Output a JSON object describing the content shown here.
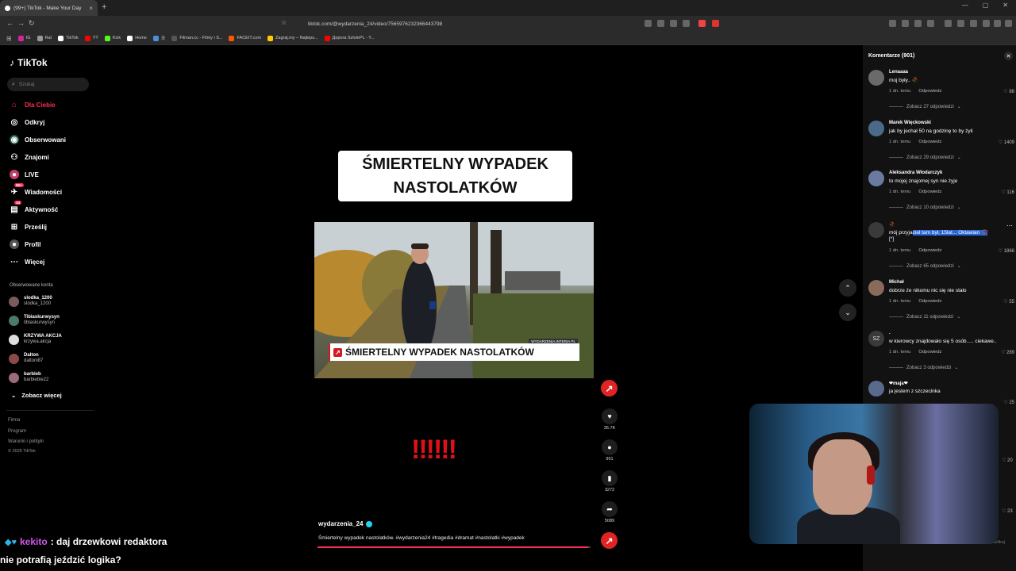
{
  "browser": {
    "tab_title": "(99+) TikTok - Make Your Day",
    "new_tab": "+",
    "url": "tiktok.com/@wydarzenia_24/video/7565976232366443798",
    "bookmarks": [
      "IG",
      "Rat",
      "TikTok",
      "YT",
      "Kick",
      "Home",
      "天",
      "Filman.cc - Filmy i S...",
      "FACEIT.com",
      "Zagraj.my – Najleps...",
      "Дорога SzlolePL - Y..."
    ]
  },
  "sidebar": {
    "logo": "TikTok",
    "search_placeholder": "Szukaj",
    "nav": [
      {
        "label": "Dla Ciebie",
        "icon": "home-icon",
        "active": true
      },
      {
        "label": "Odkryj",
        "icon": "compass-icon"
      },
      {
        "label": "Obserwowani",
        "icon": "followed-icon"
      },
      {
        "label": "Znajomi",
        "icon": "friends-icon"
      },
      {
        "label": "LIVE",
        "icon": "live-icon"
      },
      {
        "label": "Wiadomości",
        "icon": "messages-icon",
        "badge": "99+"
      },
      {
        "label": "Aktywność",
        "icon": "activity-icon",
        "badge": "14"
      },
      {
        "label": "Prześlij",
        "icon": "upload-icon"
      },
      {
        "label": "Profil",
        "icon": "profile-icon"
      },
      {
        "label": "Więcej",
        "icon": "more-icon"
      }
    ],
    "followed_title": "Obserwowane konta",
    "accounts": [
      {
        "name": "slodka_1200",
        "handle": "slodka_1200"
      },
      {
        "name": "Tibiaskurwysyn",
        "handle": "tibiaskurwysyn"
      },
      {
        "name": "KRZYWA AKCJA",
        "handle": "krzywa.akcja"
      },
      {
        "name": "Dalton",
        "handle": "daltoni87"
      },
      {
        "name": "barbieb",
        "handle": "barbiebie22"
      }
    ],
    "see_more": "Zobacz więcej",
    "footer": [
      "Firma",
      "Program",
      "Warunki i polityki",
      "© 2025 TikTok"
    ]
  },
  "video": {
    "headline_line1": "ŚMIERTELNY WYPADEK",
    "headline_line2": "NASTOLATKÓW",
    "lower_third": "ŚMIERTELNY WYPADEK NASTOLATKÓW",
    "source_tag": "WYDARZENIA.INTERIA.PL",
    "exclaim": "!!!!!!",
    "author": "wydarzenia_24",
    "caption": "Śmiertelny wypadek nastolatków. #wydarzenia24 #tragedia #dramat #nastolatki #wypadek",
    "progress": 0.99
  },
  "actions": {
    "likes": "35.7K",
    "comments": "901",
    "saves": "3272",
    "shares": "5089"
  },
  "comments": {
    "title": "Komentarze (901)",
    "items": [
      {
        "user": "Lenaaaa",
        "text": "moj były.. 🥀",
        "time": "1 dn. temu",
        "reply": "Odpowiedz",
        "likes": "88",
        "more": "Zobacz 27 odpowiedzi"
      },
      {
        "user": "Marek Więckowski",
        "text": "jak by jechał 50 na godzinę to by żyli",
        "time": "1 dn. temu",
        "reply": "Odpowiedz",
        "likes": "1409",
        "more": "Zobacz 29 odpowiedzi"
      },
      {
        "user": "Aleksandra Włodarczyk",
        "text": "to mojej znajomej syn nie żyje",
        "time": "1 dn. temu",
        "reply": "Odpowiedz",
        "likes": "116",
        "more": "Zobacz 10 odpowiedzi"
      },
      {
        "user": "🥀",
        "text_plain": "mój przyja",
        "text_selected": "ciel tam był, 15lat... Oktawian 🥀",
        "text_tail": "[*]",
        "time": "1 dn. temu",
        "reply": "Odpowiedz",
        "likes": "1866",
        "more": "Zobacz 65 odpowiedzi"
      },
      {
        "user": "Michał",
        "text": "dobrze że nikomu nic się nie stało",
        "time": "1 dn. temu",
        "reply": "Odpowiedz",
        "likes": "55",
        "more": "Zobacz 11 odpowiedzi"
      },
      {
        "user": ".",
        "avatar_text": "SZ",
        "text": "w kierowcy znajdowało się 5 osób..... ciekawe..",
        "time": "1 dn. temu",
        "reply": "Odpowiedz",
        "likes": "289",
        "more": "Zobacz 3 odpowiedzi"
      },
      {
        "user": "❤maja❤",
        "text": "ja jestem z szczecinka",
        "time": "1 dn. temu",
        "reply": "Odpowiedz",
        "likes": "25"
      }
    ],
    "extra_likes": [
      "20",
      "23"
    ],
    "footer_text": "Opublikuj"
  },
  "stream_chat": {
    "line1_user": "kekito",
    "line1_text": ": daj drzewkowi redaktora",
    "line2_text": "nie potrafią jeździć logika?"
  }
}
